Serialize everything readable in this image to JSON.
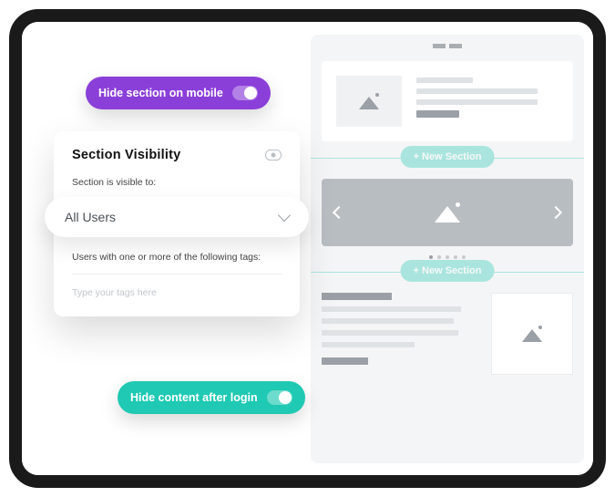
{
  "toggles": {
    "hide_mobile_label": "Hide section on mobile",
    "hide_after_login_label": "Hide content after login"
  },
  "visibility": {
    "title": "Section Visibility",
    "visible_to_label": "Section is visible to:",
    "selected": "All Users",
    "tags_label": "Users with one or more of the following tags:",
    "tags_placeholder": "Type your tags here"
  },
  "preview": {
    "new_section_label": "+ New Section"
  },
  "colors": {
    "purple": "#8b3fd9",
    "teal": "#1fc9b3"
  }
}
